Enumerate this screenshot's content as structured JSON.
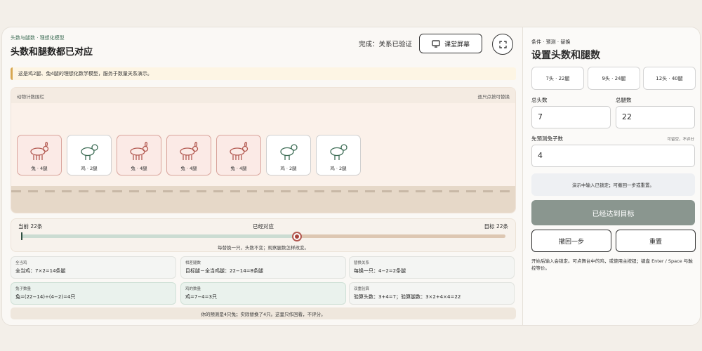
{
  "header": {
    "kicker": "头数与腿数 · 理想化模型",
    "title": "头数和腿数都已对应",
    "status": "完成：关系已验证",
    "screen_button": "课堂屏幕"
  },
  "notice": "这是鸡2腿、兔4腿的理想化数学模型，服务于数量关系演示。",
  "stage": {
    "label": "动物计数围栏",
    "hint": "逐只点按可替换",
    "animals": [
      {
        "kind": "rabbit",
        "label": "兔 · 4腿"
      },
      {
        "kind": "chicken",
        "label": "鸡 · 2腿"
      },
      {
        "kind": "rabbit",
        "label": "兔 · 4腿"
      },
      {
        "kind": "rabbit",
        "label": "兔 · 4腿"
      },
      {
        "kind": "rabbit",
        "label": "兔 · 4腿"
      },
      {
        "kind": "chicken",
        "label": "鸡 · 2腿"
      },
      {
        "kind": "chicken",
        "label": "鸡 · 2腿"
      }
    ]
  },
  "progress": {
    "current": "当前 22条",
    "middle": "已经对应",
    "target": "目标 22条",
    "note": "每替换一只，头数不变；观察腿数怎样改变。",
    "level": 0.57
  },
  "info": {
    "all_chicken_k": "全当鸡",
    "all_chicken_v": "全当鸡：7×2=14条腿",
    "diff_k": "相差腿数",
    "diff_v": "目标腿－全当鸡腿：22−14=8条腿",
    "swap_k": "替换关系",
    "swap_v": "每换一只：4−2=2条腿",
    "rabbit_k": "兔子数量",
    "rabbit_v": "兔=(22−14)÷(4−2)=4只",
    "chicken_k": "鸡的数量",
    "chicken_v": "鸡=7−4=3只",
    "check_k": "双重验算",
    "check_v": "验算头数：3+4=7；验算腿数：3×2+4×4=22"
  },
  "footer": "你的预测是4只兔；实际替换了4只。这里只作回看，不评分。",
  "side": {
    "kicker": "条件 · 预测 · 替换",
    "title": "设置头数和腿数",
    "presets": [
      "7头 · 22腿",
      "9头 · 24腿",
      "12头 · 40腿"
    ],
    "heads_label": "总头数",
    "heads_value": "7",
    "legs_label": "总腿数",
    "legs_value": "22",
    "predict_label": "先预测兔子数",
    "predict_hint": "可留空，不评分",
    "predict_value": "4",
    "lock_note": "演示中输入已锁定；可撤回一步或重置。",
    "reach_button": "已经达到目标",
    "undo_button": "撤回一步",
    "reset_button": "重置",
    "kb_note": "开始后输入会锁定。可点舞台中的鸡，或使用主按钮；键盘 Enter / Space 与触控等价。"
  },
  "colors": {
    "accent": "#3f6e57",
    "rabbit": "#b35a52",
    "chicken": "#3f6e57"
  }
}
